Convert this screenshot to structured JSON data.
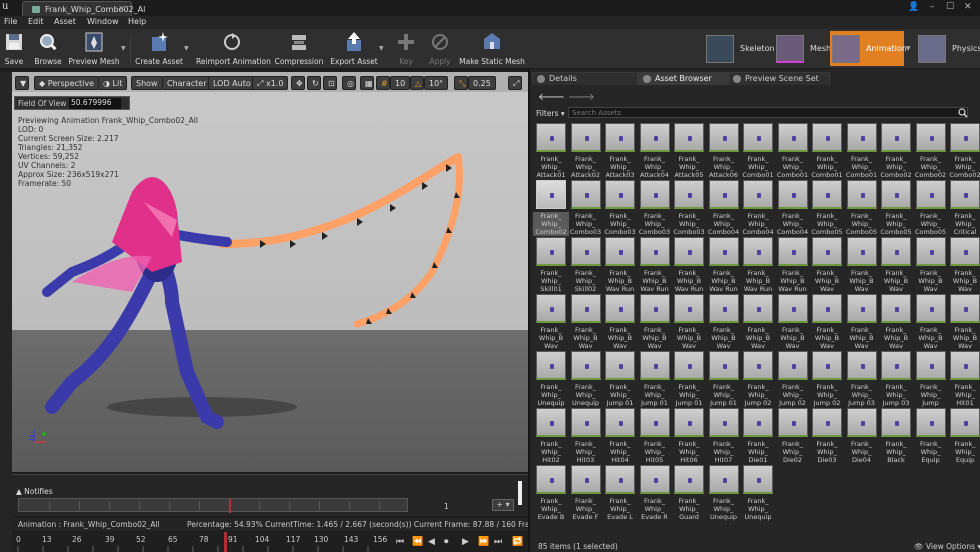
{
  "app": {
    "doc_tab": "Frank_Whip_Combo02_Al",
    "menu": [
      "File",
      "Edit",
      "Asset",
      "Window",
      "Help"
    ]
  },
  "toolbar": {
    "buttons": [
      "Save",
      "Browse",
      "Preview Mesh",
      "Create Asset",
      "Reimport Animation",
      "Compression",
      "Export Asset",
      "Key",
      "Apply",
      "Make Static Mesh"
    ],
    "modes": [
      "Skeleton",
      "Mesh",
      "Animation",
      "Physics"
    ]
  },
  "viewport": {
    "toolbar": {
      "perspective": "Perspective",
      "lit": "Lit",
      "show": "Show",
      "character": "Character",
      "lod": "LOD Auto",
      "speed": "x1.0",
      "grid_snap": "10",
      "rot_snap": "10°",
      "scale_snap": "0.25"
    },
    "fov_label": "Field Of View",
    "fov_value": "50.679996",
    "stats": [
      "Previewing Animation Frank_Whip_Combo02_All",
      "LOD: 0",
      "Current Screen Size: 2.217",
      "Triangles: 21,352",
      "Vertices: 59,252",
      "UV Channels: 2",
      "Approx Size: 236x519x271",
      "Framerate: 50"
    ]
  },
  "notifies": {
    "label": "Notifies",
    "track_count": "1",
    "add_button": "+ ▾"
  },
  "status": {
    "animation": "Animation : Frank_Whip_Combo02_All",
    "progress": "Percentage: 54.93% CurrentTime: 1.465 / 2.667 (second(s)) Current Frame: 87.88 / 160 Frame"
  },
  "timeline": {
    "ticks": [
      "0",
      "13",
      "26",
      "39",
      "52",
      "65",
      "78",
      "91",
      "104",
      "117",
      "130",
      "143",
      "156"
    ]
  },
  "panel": {
    "tabs": [
      "Details",
      "Asset Browser",
      "Preview Scene Set"
    ],
    "filters": "Filters ▾",
    "search_placeholder": "Search Assets",
    "items_count": "85 items (1 selected)",
    "view_options": "👁 View Options ▾",
    "assets": [
      "Frank_\nWhip_\nAttack01",
      "Frank_\nWhip_\nAttack02",
      "Frank_\nWhip_\nAttack03",
      "Frank_\nWhip_\nAttack04",
      "Frank_\nWhip_\nAttack05",
      "Frank_\nWhip_\nAttack06",
      "Frank_\nWhip_\nCombo01",
      "Frank_\nWhip_\nCombo01",
      "Frank_\nWhip_\nCombo01",
      "Frank_\nWhip_\nCombo01",
      "Frank_\nWhip_\nCombo02",
      "Frank_\nWhip_\nCombo02",
      "Frank_\nWhip_\nCombo02",
      "Frank_\nWhip_\nCombo02",
      "Frank_\nWhip_\nCombo03",
      "Frank_\nWhip_\nCombo03",
      "Frank_\nWhip_\nCombo03",
      "Frank_\nWhip_\nCombo03",
      "Frank_\nWhip_\nCombo04",
      "Frank_\nWhip_\nCombo04",
      "Frank_\nWhip_\nCombo04",
      "Frank_\nWhip_\nCombo05",
      "Frank_\nWhip_\nCombo05",
      "Frank_\nWhip_\nCombo05",
      "Frank_\nWhip_\nCombo05",
      "Frank_\nWhip_\nCritical",
      "Frank_\nWhip_\nSkill01",
      "Frank_\nWhip_\nSkill02",
      "Frank_\nWhip_B\nWav Run",
      "Frank_\nWhip_B\nWav Run",
      "Frank_\nWhip_B\nWav Run",
      "Frank_\nWhip_B\nWav Run",
      "Frank_\nWhip_B\nWav Run",
      "Frank_\nWhip_B\nWav Run",
      "Frank_\nWhip_B\nWav",
      "Frank_\nWhip_B\nWav",
      "Frank_\nWhip_B\nWav",
      "Frank_\nWhip_B\nWav",
      "Frank_\nWhip_B\nWav",
      "Frank_\nWhip_B\nWav",
      "Frank_\nWhip_B\nWav",
      "Frank_\nWhip_B\nWav",
      "Frank_\nWhip_B\nWav",
      "Frank_\nWhip_B\nWav",
      "Frank_\nWhip_B\nWav",
      "Frank_\nWhip_B\nWav",
      "Frank_\nWhip_B\nWav",
      "Frank_\nWhip_B\nWav",
      "Frank_\nWhip_B\nWav",
      "Frank_\nWhip_B\nWav",
      "Frank_\nWhip_B\nWav",
      "Frank_\nWhip_B\nWav",
      "Frank_\nWhip_\nUnequip",
      "Frank_\nWhip_\nUnequip",
      "Frank_\nWhip_\nJump 01",
      "Frank_\nWhip_\nJump 01",
      "Frank_\nWhip_\nJump 01",
      "Frank_\nWhip_\nJump 01",
      "Frank_\nWhip_\nJump 02",
      "Frank_\nWhip_\nJump 02",
      "Frank_\nWhip_\nJump 02",
      "Frank_\nWhip_\nJump 03",
      "Frank_\nWhip_\nJump 03",
      "Frank_\nWhip_\nJump",
      "Frank_\nWhip_\nHit01",
      "Frank_\nWhip_\nHit02",
      "Frank_\nWhip_\nHit03",
      "Frank_\nWhip_\nHit04",
      "Frank_\nWhip_\nHit05",
      "Frank_\nWhip_\nHit06",
      "Frank_\nWhip_\nHit07",
      "Frank_\nWhip_\nDie01",
      "Frank_\nWhip_\nDie02",
      "Frank_\nWhip_\nDie03",
      "Frank_\nWhip_\nDie04",
      "Frank_\nWhip_\nBlack",
      "Frank_\nWhip_\nEquip",
      "Frank_\nWhip_\nEquip",
      "Frank_\nWhip_\nEvade B",
      "Frank_\nWhip_\nEvade F",
      "Frank_\nWhip_\nEvade L",
      "Frank_\nWhip_\nEvade R",
      "Frank_\nWhip_\nGuard",
      "Frank_\nWhip_\nUnequip",
      "Frank_\nWhip_\nUnequip"
    ]
  }
}
